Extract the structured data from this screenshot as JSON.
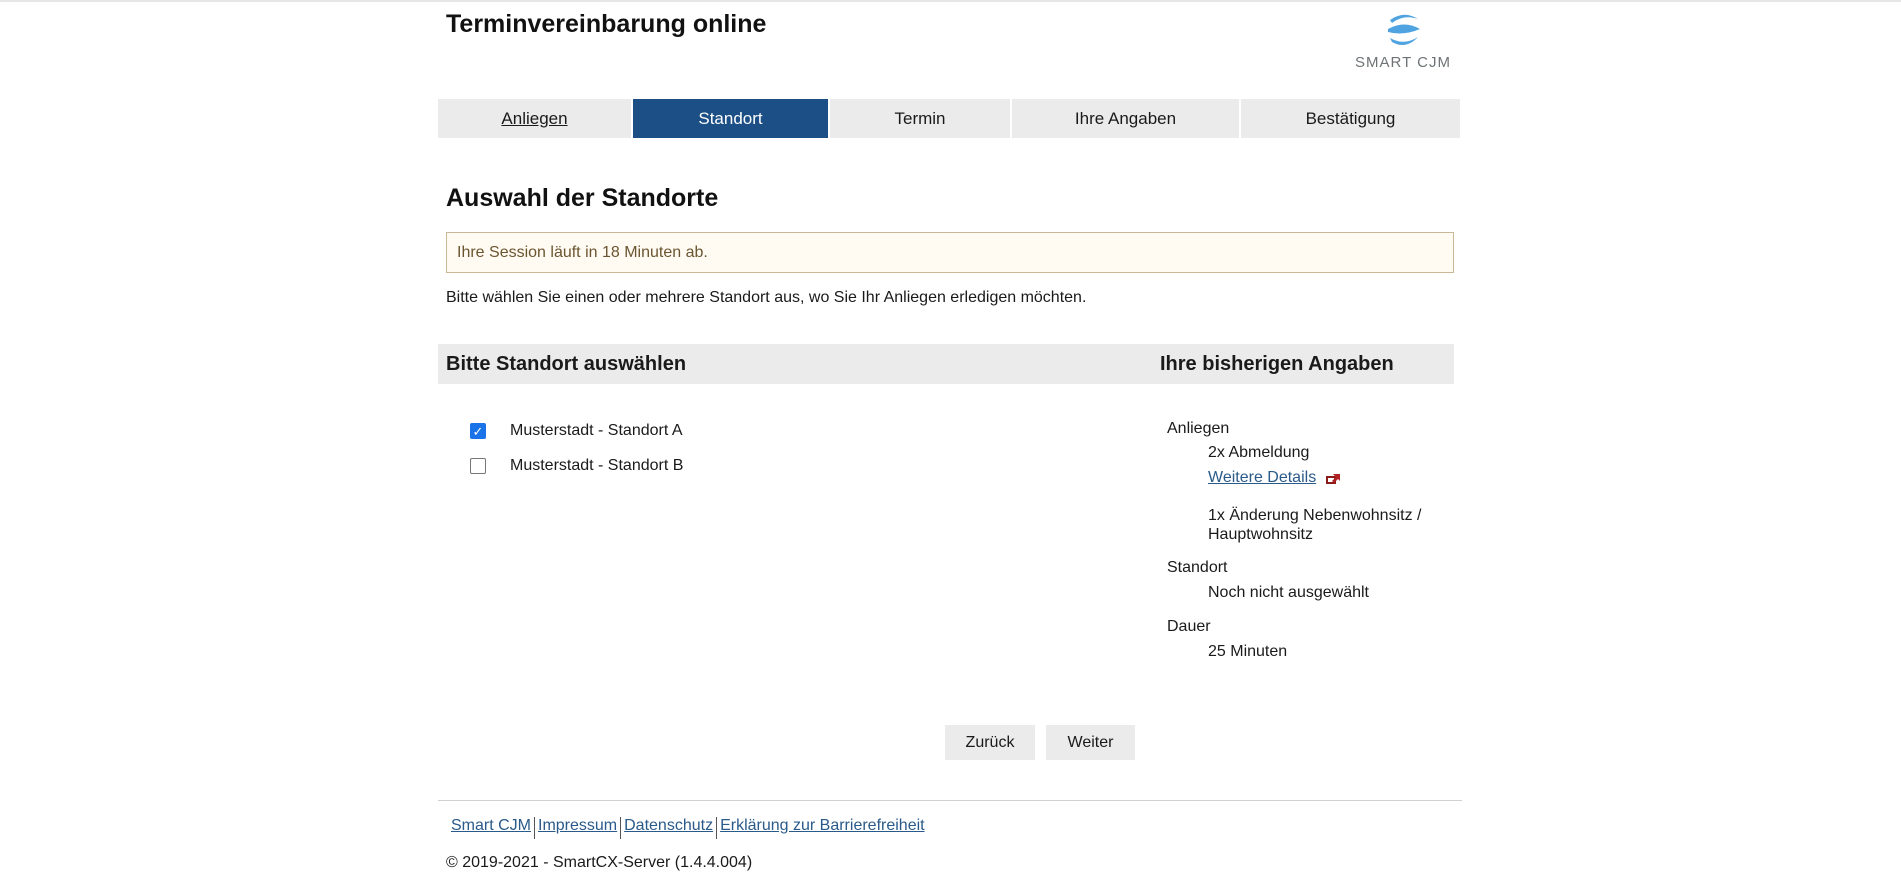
{
  "header": {
    "title": "Terminvereinbarung online",
    "logo_text": "SMART CJM"
  },
  "tabs": [
    {
      "label": "Anliegen",
      "state": "link"
    },
    {
      "label": "Standort",
      "state": "active"
    },
    {
      "label": "Termin",
      "state": "inactive"
    },
    {
      "label": "Ihre Angaben",
      "state": "inactive"
    },
    {
      "label": "Bestätigung",
      "state": "inactive"
    }
  ],
  "main": {
    "section_title": "Auswahl der Standorte",
    "session_notice": "Ihre Session läuft in 18 Minuten ab.",
    "intro_text": "Bitte wählen Sie einen oder mehrere Standort aus, wo Sie Ihr Anliegen erledigen möchten.",
    "left_heading": "Bitte Standort auswählen",
    "right_heading": "Ihre bisherigen Angaben",
    "locations": [
      {
        "label": "Musterstadt - Standort A",
        "checked": true
      },
      {
        "label": "Musterstadt - Standort B",
        "checked": false
      }
    ]
  },
  "summary": {
    "concern_label": "Anliegen",
    "concern_item_1": "2x Abmeldung",
    "details_link": "Weitere Details",
    "concern_item_2_line1": "1x Änderung Nebenwohnsitz /",
    "concern_item_2_line2": "Hauptwohnsitz",
    "location_label": "Standort",
    "location_value": "Noch nicht ausgewählt",
    "duration_label": "Dauer",
    "duration_value": "25 Minuten"
  },
  "buttons": {
    "back": "Zurück",
    "next": "Weiter"
  },
  "footer": {
    "links": [
      "Smart CJM",
      "Impressum",
      "Datenschutz",
      "Erklärung zur Barrierefreiheit"
    ],
    "copyright": "© 2019-2021 - SmartCX-Server (1.4.4.004)"
  },
  "colors": {
    "active_tab": "#1b4f86",
    "tab_bg": "#ebebeb",
    "notice_bg": "#fffaf2",
    "notice_border": "#c8b896",
    "link": "#2a5a8a",
    "checkbox_checked": "#1a73e8",
    "logo_blue": "#4fa3e0"
  },
  "icons": {
    "logo": "smart-cjm-s-logo",
    "external_link": "external-link-icon"
  }
}
